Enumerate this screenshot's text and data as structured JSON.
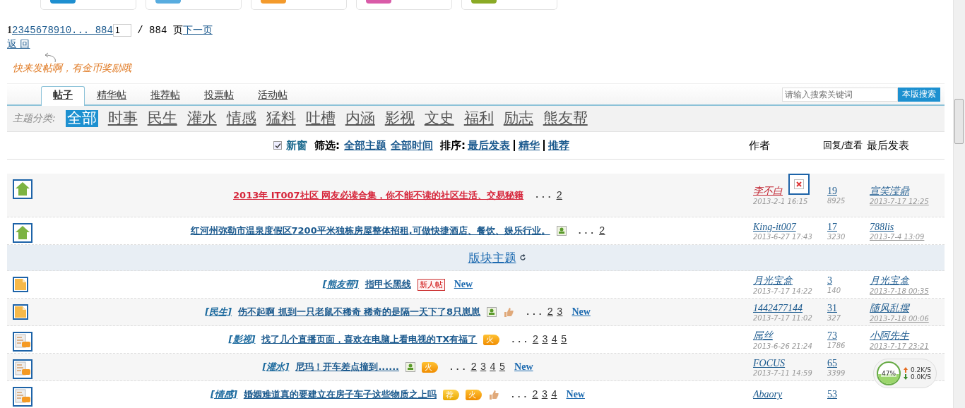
{
  "top_cards": [
    {
      "color": "#1e8fd0"
    },
    {
      "color": "#58acdf"
    },
    {
      "color": "#f39a2c"
    },
    {
      "color": "#d95ba8"
    },
    {
      "color": "#8aaa26"
    }
  ],
  "pagination": {
    "current": "1",
    "pages": [
      "2",
      "3",
      "4",
      "5",
      "6",
      "7",
      "8",
      "9",
      "10",
      "... 884"
    ],
    "input_value": "1",
    "total": " / 884 页",
    "next": "下一页"
  },
  "back_link": "返 回",
  "hint": "快来发帖啊，有金币奖励哦",
  "tabs": [
    {
      "label": "帖子",
      "selected": true
    },
    {
      "label": "精华帖",
      "selected": false
    },
    {
      "label": "推荐帖",
      "selected": false
    },
    {
      "label": "投票帖",
      "selected": false
    },
    {
      "label": "活动帖",
      "selected": false
    }
  ],
  "search": {
    "placeholder": "请输入搜索关键词",
    "button": "本版搜索"
  },
  "categories": {
    "label": "主题分类:",
    "items": [
      {
        "label": "全部",
        "selected": true
      },
      {
        "label": "时事",
        "selected": false
      },
      {
        "label": "民生",
        "selected": false
      },
      {
        "label": "灌水",
        "selected": false
      },
      {
        "label": "情感",
        "selected": false
      },
      {
        "label": "猛料",
        "selected": false
      },
      {
        "label": "吐槽",
        "selected": false
      },
      {
        "label": "内涵",
        "selected": false
      },
      {
        "label": "影视",
        "selected": false
      },
      {
        "label": "文史",
        "selected": false
      },
      {
        "label": "福利",
        "selected": false
      },
      {
        "label": "励志",
        "selected": false
      },
      {
        "label": "熊友帮",
        "selected": false
      }
    ]
  },
  "filters": {
    "new_window": {
      "label": "新窗",
      "checked": true
    },
    "filter_label": "筛选:",
    "filter_links": [
      "全部主题",
      "全部时间"
    ],
    "sort_label": "排序:",
    "sort_links": [
      "最后发表",
      "精华",
      "推荐"
    ]
  },
  "columns": {
    "author": "作者",
    "replies": "回复/查看",
    "last": "最后发表"
  },
  "rows": [
    {
      "kind": "pinned",
      "title": "2013年 IT007社区 网友必读合集，你不能不读的社区生活、交易秘籍",
      "highlight": true,
      "badges": [],
      "ellipsis": "...",
      "pages": [
        "2"
      ],
      "broken_image": true,
      "author": "李不白",
      "author_highlight": true,
      "date": "2013-2-1 16:15",
      "replies": "19",
      "views": "8925",
      "last_poster": "宣笑滢鼎",
      "last_date": "2013-7-17 12:25"
    },
    {
      "kind": "pinned",
      "title": "红河州弥勒市温泉度假区7200平米独栋房屋整体招租,可做快捷酒店、餐饮、娱乐行业。",
      "highlight": false,
      "badges": [
        {
          "kind": "image"
        }
      ],
      "ellipsis": "...",
      "pages": [
        "2"
      ],
      "author": "King-it007",
      "author_highlight": false,
      "date": "2013-6-27 17:43",
      "replies": "17",
      "views": "3230",
      "last_poster": "788lis",
      "last_date": "2013-7-4 13:09"
    },
    {
      "kind": "section",
      "title": "版块主题"
    },
    {
      "kind": "normal",
      "category": "[熊友帮]",
      "title": "指甲长黑线",
      "highlight": false,
      "badges": [
        {
          "kind": "label",
          "text": "新人帖"
        }
      ],
      "new": "New",
      "author": "月光宝盒",
      "author_highlight": false,
      "date": "2013-7-17 14:22",
      "replies": "3",
      "views": "140",
      "last_poster": "月光宝盒",
      "last_date": "2013-7-18 00:35"
    },
    {
      "kind": "normal",
      "category": "[民生]",
      "title": "伤不起啊 抓到一只老鼠不稀奇 稀奇的是隔一天下了8只崽崽",
      "highlight": false,
      "badges": [
        {
          "kind": "image"
        },
        {
          "kind": "thumb"
        }
      ],
      "ellipsis": "...",
      "pages": [
        "2",
        "3"
      ],
      "new": "New",
      "author": "1442477144",
      "author_highlight": false,
      "date": "2013-7-17 11:02",
      "replies": "31",
      "views": "327",
      "last_poster": "随风乱摆",
      "last_date": "2013-7-18 00:06"
    },
    {
      "kind": "hot",
      "category": "[影视]",
      "title": "找了几个直播页面，喜欢在电脑上看电视的TX有福了",
      "highlight": false,
      "badges": [
        {
          "kind": "fire",
          "text": "火"
        }
      ],
      "ellipsis": "...",
      "pages": [
        "2",
        "3",
        "4",
        "5"
      ],
      "author": "屌丝",
      "author_highlight": false,
      "date": "2013-6-26 21:24",
      "replies": "73",
      "views": "1786",
      "last_poster": "小阿先生",
      "last_date": "2013-7-17 23:21"
    },
    {
      "kind": "hot",
      "category": "[灌水]",
      "title": "尼玛！开车差点撞到......",
      "highlight": false,
      "badges": [
        {
          "kind": "image"
        },
        {
          "kind": "fire",
          "text": "火"
        }
      ],
      "ellipsis": "...",
      "pages": [
        "2",
        "3",
        "4",
        "5"
      ],
      "new": "New",
      "author": "FOCUS",
      "author_highlight": false,
      "date": "2013-7-11 14:59",
      "replies": "65",
      "views": "3399"
    },
    {
      "kind": "hot",
      "category": "[情感]",
      "title": "婚姻难道真的要建立在房子车子这些物质之上吗",
      "highlight": false,
      "badges": [
        {
          "kind": "recommend",
          "text": "荐"
        },
        {
          "kind": "fire",
          "text": "火"
        },
        {
          "kind": "thumb"
        }
      ],
      "ellipsis": "...",
      "pages": [
        "2",
        "3",
        "4"
      ],
      "new": "New",
      "author": "Abaory",
      "author_highlight": false,
      "replies": "53"
    }
  ],
  "speed_widget": {
    "percent": "47%",
    "up": "0.2K/S",
    "down": "0.0K/S"
  }
}
